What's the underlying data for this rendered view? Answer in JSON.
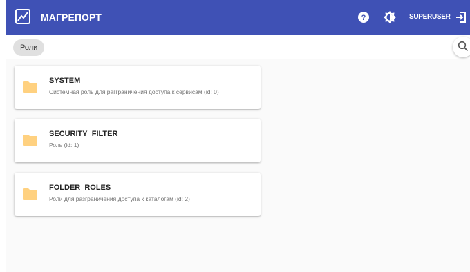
{
  "header": {
    "app_title": "МАГРЕПОРТ",
    "user": "SUPERUSER",
    "accent_color": "#3f51b5",
    "icons": [
      "logo-chart-icon",
      "help-icon",
      "theme-toggle-icon",
      "logout-icon"
    ]
  },
  "breadcrumb": {
    "current": "Роли"
  },
  "search": {
    "icon": "search-icon"
  },
  "roles": [
    {
      "name": "SYSTEM",
      "description": "Системная роль для рагграничения доступа к сервисам (id: 0)"
    },
    {
      "name": "SECURITY_FILTER",
      "description": "Роль (id: 1)"
    },
    {
      "name": "FOLDER_ROLES",
      "description": "Роли для разграничения доступа к каталогам (id: 2)"
    }
  ],
  "folder_color": "#ffd180"
}
